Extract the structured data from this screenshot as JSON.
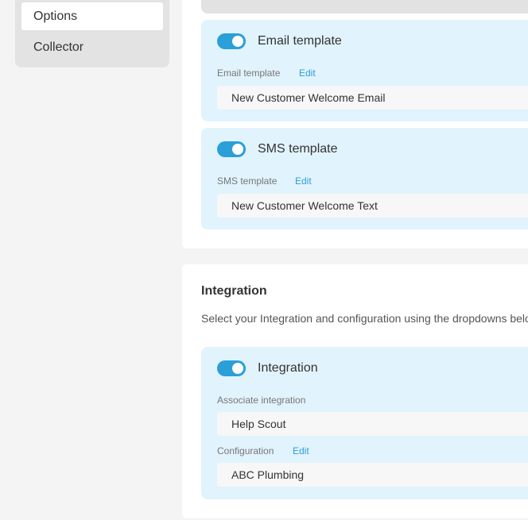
{
  "sidebar": {
    "items": [
      {
        "label": "Options"
      },
      {
        "label": "Collector"
      }
    ]
  },
  "email_block": {
    "title": "Email template",
    "field_label": "Email template",
    "edit_label": "Edit",
    "value": "New Customer Welcome Email"
  },
  "sms_block": {
    "title": "SMS template",
    "field_label": "SMS template",
    "edit_label": "Edit",
    "value": "New Customer Welcome Text"
  },
  "integration_section": {
    "title": "Integration",
    "description": "Select your Integration and configuration using the dropdowns belo"
  },
  "integration_block": {
    "title": "Integration",
    "associate_label": "Associate integration",
    "associate_value": "Help Scout",
    "config_label": "Configuration",
    "config_edit_label": "Edit",
    "config_value": "ABC Plumbing"
  },
  "colors": {
    "accent": "#2a9fd8",
    "block_bg": "#e1f3fc",
    "page_bg": "#f4f4f4"
  }
}
